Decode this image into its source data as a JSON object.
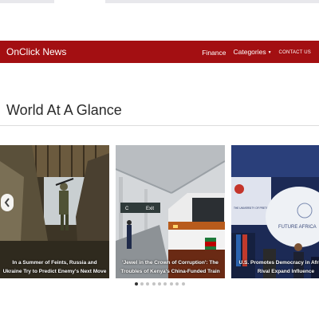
{
  "navbar": {
    "brand": "OnClick News",
    "links": [
      "Finance",
      "Categories",
      "CONTACT US"
    ]
  },
  "section": {
    "title": "World At A Glance"
  },
  "carousel": {
    "slides": [
      {
        "caption": "In a Summer of Feints, Russia and Ukraine Try to Predict Enemy's Next Move"
      },
      {
        "caption": "'Jewel in the Crown of Corruption': The Troubles of Kenya's China-Funded Train"
      },
      {
        "caption": "U.S. Promotes Democracy in Africa as Rival Expand Influence"
      }
    ],
    "slide2_signs": {
      "left_sign": "C",
      "right_sign": "Exit"
    },
    "slide3_screen": {
      "left_screen": "THE UNIVERSITY OF PRETORIA",
      "right_screen": "FUTURE AFRICA"
    },
    "active_index": 0,
    "dot_count": 9
  },
  "colors": {
    "brand_red": "#a30f12",
    "dot_active": "#333333",
    "dot_inactive": "#c4c4c4"
  },
  "icons": {
    "prev": "chevron-left-icon",
    "caret": "caret-down-icon"
  }
}
